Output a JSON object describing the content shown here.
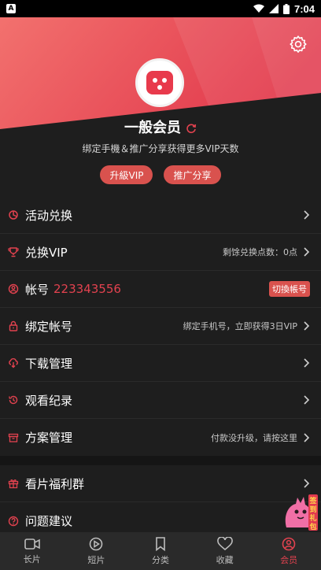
{
  "status_bar": {
    "time": "7:04",
    "app_indicator": "A"
  },
  "profile": {
    "level": "一般会员",
    "subtitle": "绑定手機＆推广分享获得更多VIP天数",
    "upgrade_label": "升級VIP",
    "share_label": "推广分享"
  },
  "menu": {
    "activity": {
      "label": "活动兑换"
    },
    "redeem_vip": {
      "label": "兑换VIP",
      "value": "剩馀兑换点数：0点"
    },
    "account": {
      "label": "帐号",
      "number": "223343556",
      "switch_label": "切換帳号"
    },
    "bind_account": {
      "label": "绑定帐号",
      "value": "绑定手机号，立即获得3日VIP"
    },
    "downloads": {
      "label": "下载管理"
    },
    "history": {
      "label": "观看纪录"
    },
    "plans": {
      "label": "方案管理",
      "value": "付款没升级，请按这里"
    },
    "group": {
      "label": "看片福利群"
    },
    "feedback": {
      "label": "问题建议"
    }
  },
  "floating_badge": {
    "text": "签到礼包"
  },
  "tabs": [
    {
      "label": "长片",
      "icon": "video-camera-icon"
    },
    {
      "label": "短片",
      "icon": "play-circle-icon"
    },
    {
      "label": "分类",
      "icon": "bookmark-icon"
    },
    {
      "label": "收藏",
      "icon": "heart-icon"
    },
    {
      "label": "会员",
      "icon": "user-circle-icon",
      "active": true
    }
  ],
  "colors": {
    "accent": "#e2424f",
    "button": "#d9524e",
    "background": "#1e1e1e"
  }
}
